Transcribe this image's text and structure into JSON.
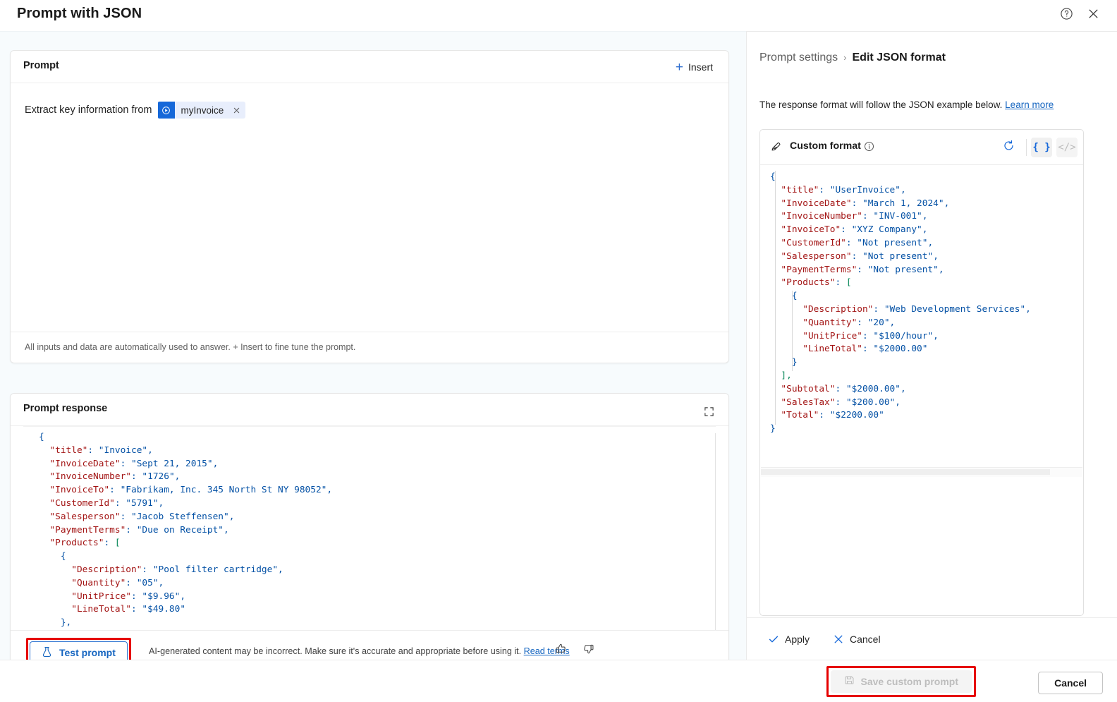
{
  "window": {
    "title": "Prompt with JSON",
    "help_icon": "help-circle-icon",
    "close_icon": "close-icon"
  },
  "prompt_card": {
    "heading": "Prompt",
    "insert_label": "Insert",
    "insert_icon": "plus-icon",
    "prompt_text": "Extract key information from",
    "chip": {
      "icon": "power-automate-icon",
      "label": "myInvoice",
      "remove_icon": "close-icon"
    },
    "hint": "All inputs and data are automatically used to answer. + Insert to fine tune the prompt."
  },
  "response_card": {
    "heading": "Prompt response",
    "expand_icon": "expand-icon",
    "test_button_label": "Test prompt",
    "test_button_icon": "flask-icon",
    "disclaimer": "AI-generated content may be incorrect. Make sure it's accurate and appropriate before using it.",
    "read_terms_label": "Read terms",
    "thumbs_up_icon": "thumbs-up-icon",
    "thumbs_down_icon": "thumbs-down-icon",
    "code_lines": [
      {
        "indent": 0,
        "tokens": [
          {
            "t": "{",
            "c": "br"
          }
        ]
      },
      {
        "indent": 1,
        "tokens": [
          {
            "t": "\"title\"",
            "c": "k"
          },
          {
            "t": ": ",
            "c": "p"
          },
          {
            "t": "\"Invoice\"",
            "c": "s"
          },
          {
            "t": ",",
            "c": "p"
          }
        ]
      },
      {
        "indent": 1,
        "tokens": [
          {
            "t": "\"InvoiceDate\"",
            "c": "k"
          },
          {
            "t": ": ",
            "c": "p"
          },
          {
            "t": "\"Sept 21, 2015\"",
            "c": "s"
          },
          {
            "t": ",",
            "c": "p"
          }
        ]
      },
      {
        "indent": 1,
        "tokens": [
          {
            "t": "\"InvoiceNumber\"",
            "c": "k"
          },
          {
            "t": ": ",
            "c": "p"
          },
          {
            "t": "\"1726\"",
            "c": "s"
          },
          {
            "t": ",",
            "c": "p"
          }
        ]
      },
      {
        "indent": 1,
        "tokens": [
          {
            "t": "\"InvoiceTo\"",
            "c": "k"
          },
          {
            "t": ": ",
            "c": "p"
          },
          {
            "t": "\"Fabrikam, Inc. 345 North St NY 98052\"",
            "c": "s"
          },
          {
            "t": ",",
            "c": "p"
          }
        ]
      },
      {
        "indent": 1,
        "tokens": [
          {
            "t": "\"CustomerId\"",
            "c": "k"
          },
          {
            "t": ": ",
            "c": "p"
          },
          {
            "t": "\"5791\"",
            "c": "s"
          },
          {
            "t": ",",
            "c": "p"
          }
        ]
      },
      {
        "indent": 1,
        "tokens": [
          {
            "t": "\"Salesperson\"",
            "c": "k"
          },
          {
            "t": ": ",
            "c": "p"
          },
          {
            "t": "\"Jacob Steffensen\"",
            "c": "s"
          },
          {
            "t": ",",
            "c": "p"
          }
        ]
      },
      {
        "indent": 1,
        "tokens": [
          {
            "t": "\"PaymentTerms\"",
            "c": "k"
          },
          {
            "t": ": ",
            "c": "p"
          },
          {
            "t": "\"Due on Receipt\"",
            "c": "s"
          },
          {
            "t": ",",
            "c": "p"
          }
        ]
      },
      {
        "indent": 1,
        "tokens": [
          {
            "t": "\"Products\"",
            "c": "k"
          },
          {
            "t": ": ",
            "c": "p"
          },
          {
            "t": "[",
            "c": "bk"
          }
        ]
      },
      {
        "indent": 2,
        "tokens": [
          {
            "t": "{",
            "c": "br"
          }
        ]
      },
      {
        "indent": 3,
        "tokens": [
          {
            "t": "\"Description\"",
            "c": "k"
          },
          {
            "t": ": ",
            "c": "p"
          },
          {
            "t": "\"Pool filter cartridge\"",
            "c": "s"
          },
          {
            "t": ",",
            "c": "p"
          }
        ]
      },
      {
        "indent": 3,
        "tokens": [
          {
            "t": "\"Quantity\"",
            "c": "k"
          },
          {
            "t": ": ",
            "c": "p"
          },
          {
            "t": "\"05\"",
            "c": "s"
          },
          {
            "t": ",",
            "c": "p"
          }
        ]
      },
      {
        "indent": 3,
        "tokens": [
          {
            "t": "\"UnitPrice\"",
            "c": "k"
          },
          {
            "t": ": ",
            "c": "p"
          },
          {
            "t": "\"$9.96\"",
            "c": "s"
          },
          {
            "t": ",",
            "c": "p"
          }
        ]
      },
      {
        "indent": 3,
        "tokens": [
          {
            "t": "\"LineTotal\"",
            "c": "k"
          },
          {
            "t": ": ",
            "c": "p"
          },
          {
            "t": "\"$49.80\"",
            "c": "s"
          }
        ]
      },
      {
        "indent": 2,
        "tokens": [
          {
            "t": "},",
            "c": "br"
          }
        ]
      },
      {
        "indent": 2,
        "tokens": [
          {
            "t": "{",
            "c": "br"
          }
        ]
      }
    ]
  },
  "settings_panel": {
    "breadcrumb_parent": "Prompt settings",
    "breadcrumb_separator": "›",
    "breadcrumb_current": "Edit JSON format",
    "description": "The response format will follow the JSON example below.",
    "learn_more_label": "Learn more",
    "format_card": {
      "pen_icon": "pen-edit-icon",
      "title": "Custom format",
      "info_icon": "info-icon",
      "reset_icon": "reset-icon",
      "json_toggle_label": "{ }",
      "code_toggle_label": "</>",
      "code_lines": [
        {
          "indent": 0,
          "tokens": [
            {
              "t": "{",
              "c": "br"
            }
          ]
        },
        {
          "indent": 1,
          "tokens": [
            {
              "t": "\"title\"",
              "c": "k"
            },
            {
              "t": ": ",
              "c": "p"
            },
            {
              "t": "\"UserInvoice\"",
              "c": "s"
            },
            {
              "t": ",",
              "c": "p"
            }
          ]
        },
        {
          "indent": 1,
          "tokens": [
            {
              "t": "\"InvoiceDate\"",
              "c": "k"
            },
            {
              "t": ": ",
              "c": "p"
            },
            {
              "t": "\"March 1, 2024\"",
              "c": "s"
            },
            {
              "t": ",",
              "c": "p"
            }
          ]
        },
        {
          "indent": 1,
          "tokens": [
            {
              "t": "\"InvoiceNumber\"",
              "c": "k"
            },
            {
              "t": ": ",
              "c": "p"
            },
            {
              "t": "\"INV-001\"",
              "c": "s"
            },
            {
              "t": ",",
              "c": "p"
            }
          ]
        },
        {
          "indent": 1,
          "tokens": [
            {
              "t": "\"InvoiceTo\"",
              "c": "k"
            },
            {
              "t": ": ",
              "c": "p"
            },
            {
              "t": "\"XYZ Company\"",
              "c": "s"
            },
            {
              "t": ",",
              "c": "p"
            }
          ]
        },
        {
          "indent": 1,
          "tokens": [
            {
              "t": "\"CustomerId\"",
              "c": "k"
            },
            {
              "t": ": ",
              "c": "p"
            },
            {
              "t": "\"Not present\"",
              "c": "s"
            },
            {
              "t": ",",
              "c": "p"
            }
          ]
        },
        {
          "indent": 1,
          "tokens": [
            {
              "t": "\"Salesperson\"",
              "c": "k"
            },
            {
              "t": ": ",
              "c": "p"
            },
            {
              "t": "\"Not present\"",
              "c": "s"
            },
            {
              "t": ",",
              "c": "p"
            }
          ]
        },
        {
          "indent": 1,
          "tokens": [
            {
              "t": "\"PaymentTerms\"",
              "c": "k"
            },
            {
              "t": ": ",
              "c": "p"
            },
            {
              "t": "\"Not present\"",
              "c": "s"
            },
            {
              "t": ",",
              "c": "p"
            }
          ]
        },
        {
          "indent": 1,
          "tokens": [
            {
              "t": "\"Products\"",
              "c": "k"
            },
            {
              "t": ": ",
              "c": "p"
            },
            {
              "t": "[",
              "c": "bk"
            }
          ]
        },
        {
          "indent": 2,
          "tokens": [
            {
              "t": "{",
              "c": "br"
            }
          ]
        },
        {
          "indent": 3,
          "tokens": [
            {
              "t": "\"Description\"",
              "c": "k"
            },
            {
              "t": ": ",
              "c": "p"
            },
            {
              "t": "\"Web Development Services\"",
              "c": "s"
            },
            {
              "t": ",",
              "c": "p"
            }
          ]
        },
        {
          "indent": 3,
          "tokens": [
            {
              "t": "\"Quantity\"",
              "c": "k"
            },
            {
              "t": ": ",
              "c": "p"
            },
            {
              "t": "\"20\"",
              "c": "s"
            },
            {
              "t": ",",
              "c": "p"
            }
          ]
        },
        {
          "indent": 3,
          "tokens": [
            {
              "t": "\"UnitPrice\"",
              "c": "k"
            },
            {
              "t": ": ",
              "c": "p"
            },
            {
              "t": "\"$100/hour\"",
              "c": "s"
            },
            {
              "t": ",",
              "c": "p"
            }
          ]
        },
        {
          "indent": 3,
          "tokens": [
            {
              "t": "\"LineTotal\"",
              "c": "k"
            },
            {
              "t": ": ",
              "c": "p"
            },
            {
              "t": "\"$2000.00\"",
              "c": "s"
            }
          ]
        },
        {
          "indent": 2,
          "tokens": [
            {
              "t": "}",
              "c": "br"
            }
          ]
        },
        {
          "indent": 1,
          "tokens": [
            {
              "t": "],",
              "c": "bk"
            }
          ]
        },
        {
          "indent": 1,
          "tokens": [
            {
              "t": "\"Subtotal\"",
              "c": "k"
            },
            {
              "t": ": ",
              "c": "p"
            },
            {
              "t": "\"$2000.00\"",
              "c": "s"
            },
            {
              "t": ",",
              "c": "p"
            }
          ]
        },
        {
          "indent": 1,
          "tokens": [
            {
              "t": "\"SalesTax\"",
              "c": "k"
            },
            {
              "t": ": ",
              "c": "p"
            },
            {
              "t": "\"$200.00\"",
              "c": "s"
            },
            {
              "t": ",",
              "c": "p"
            }
          ]
        },
        {
          "indent": 1,
          "tokens": [
            {
              "t": "\"Total\"",
              "c": "k"
            },
            {
              "t": ": ",
              "c": "p"
            },
            {
              "t": "\"$2200.00\"",
              "c": "s"
            }
          ]
        },
        {
          "indent": 0,
          "tokens": [
            {
              "t": "}",
              "c": "br"
            }
          ]
        }
      ]
    },
    "apply_label": "Apply",
    "apply_icon": "checkmark-icon",
    "cancel_label": "Cancel",
    "cancel_icon": "close-icon"
  },
  "footer": {
    "save_label": "Save custom prompt",
    "save_icon": "save-disk-icon",
    "cancel_label": "Cancel"
  },
  "colors": {
    "accent_blue": "#1668d9",
    "link_blue": "#1565c0",
    "annotation_red": "#e60000",
    "json_key": "#a31515",
    "json_string": "#0451a5",
    "json_bracket": "#09885a",
    "left_pane_bg": "#f7fbfd"
  }
}
